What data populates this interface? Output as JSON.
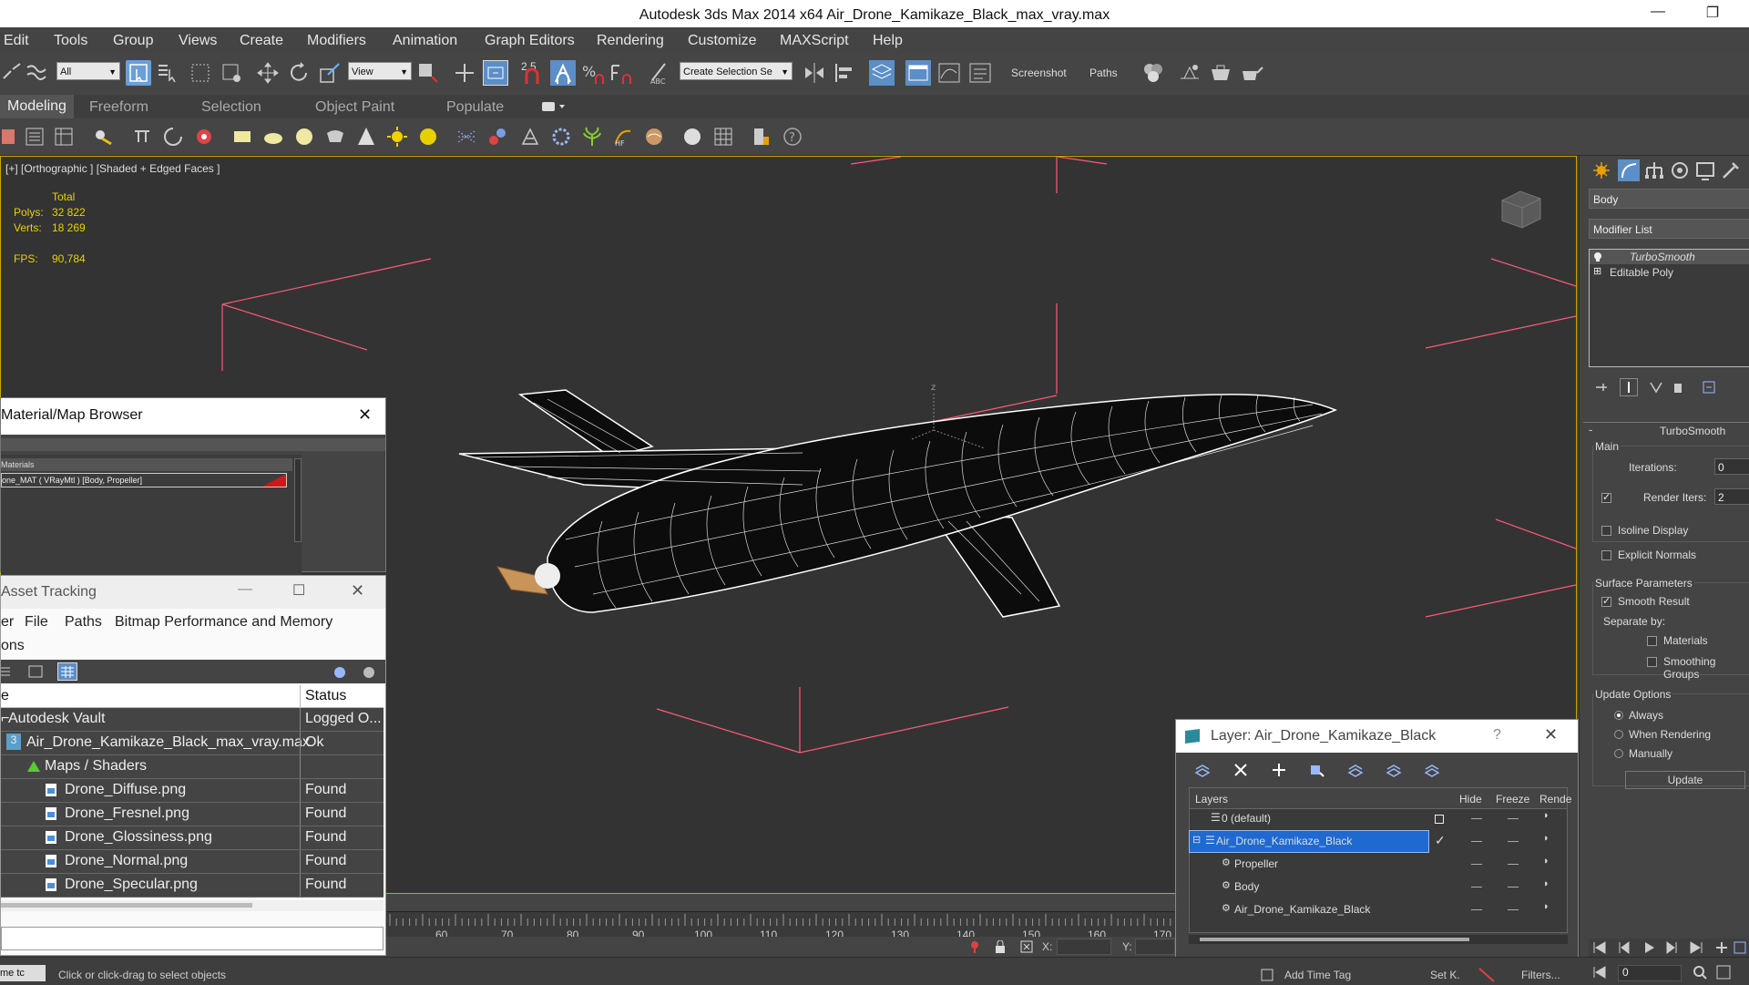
{
  "window": {
    "title": "Autodesk 3ds Max  2014 x64      Air_Drone_Kamikaze_Black_max_vray.max",
    "minimize": "—",
    "restore": "❐"
  },
  "menubar": [
    "Edit",
    "Tools",
    "Group",
    "Views",
    "Create",
    "Modifiers",
    "Animation",
    "Graph Editors",
    "Rendering",
    "Customize",
    "MAXScript",
    "Help"
  ],
  "toolbar": {
    "filter_combo": "All",
    "ref_coord_combo": "View",
    "snap_label": "2.5",
    "selection_set_combo": "Create Selection Se",
    "screenshot_label": "Screenshot",
    "paths_label": "Paths"
  },
  "ribbon_tabs": [
    "Modeling",
    "Freeform",
    "Selection",
    "Object Paint",
    "Populate"
  ],
  "viewport": {
    "label": "[+] [Orthographic ] [Shaded + Edged Faces ]",
    "stats": {
      "total_label": "Total",
      "polys_label": "Polys:",
      "polys_value": "32 822",
      "verts_label": "Verts:",
      "verts_value": "18 269",
      "fps_label": "FPS:",
      "fps_value": "90,784"
    },
    "axis_label": "z",
    "colors": {
      "bg": "#333333",
      "grid": "#ff5a78",
      "wire": "#ffffff",
      "border": "#c8a400"
    }
  },
  "command_panel": {
    "object_name": "Body",
    "modifier_list_label": "Modifier List",
    "stack": [
      "TurboSmooth",
      "Editable Poly"
    ],
    "rollout_title": "TurboSmooth",
    "main_label": "Main",
    "iterations_label": "Iterations:",
    "iterations_value": "0",
    "render_iters_label": "Render Iters:",
    "render_iters_value": "2",
    "isoline_label": "Isoline Display",
    "explicit_normals_label": "Explicit Normals",
    "surface_params_label": "Surface Parameters",
    "smooth_result_label": "Smooth Result",
    "separate_by_label": "Separate by:",
    "materials_label": "Materials",
    "smoothing_groups_label": "Smoothing Groups",
    "update_options_label": "Update Options",
    "always_label": "Always",
    "when_rendering_label": "When Rendering",
    "manually_label": "Manually",
    "update_button": "Update"
  },
  "material_browser": {
    "title": "Material/Map Browser",
    "close": "✕",
    "group_label": "Materials",
    "item": "one_MAT ( VRayMtl ) [Body, Propeller]",
    "swatch_color": "#d01818"
  },
  "asset_tracking": {
    "title": "Asset Tracking",
    "menu": [
      "er",
      "File",
      "Paths",
      "Bitmap Performance and Memory"
    ],
    "menu2": "ons",
    "col_name": "e",
    "col_status": "Status",
    "rows": [
      {
        "name": "Autodesk Vault",
        "status": "Logged O..."
      },
      {
        "name": "Air_Drone_Kamikaze_Black_max_vray.max",
        "status": "Ok"
      },
      {
        "name": "Maps / Shaders",
        "status": ""
      },
      {
        "name": "Drone_Diffuse.png",
        "status": "Found"
      },
      {
        "name": "Drone_Fresnel.png",
        "status": "Found"
      },
      {
        "name": "Drone_Glossiness.png",
        "status": "Found"
      },
      {
        "name": "Drone_Normal.png",
        "status": "Found"
      },
      {
        "name": "Drone_Specular.png",
        "status": "Found"
      }
    ]
  },
  "layer_dialog": {
    "title": "Layer: Air_Drone_Kamikaze_Black",
    "help": "?",
    "close": "✕",
    "col_layers": "Layers",
    "col_hide": "Hide",
    "col_freeze": "Freeze",
    "col_render": "Rende",
    "rows": [
      {
        "name": "0 (default)",
        "selected": false
      },
      {
        "name": "Air_Drone_Kamikaze_Black",
        "selected": true
      },
      {
        "name": "Propeller",
        "selected": false
      },
      {
        "name": "Body",
        "selected": false
      },
      {
        "name": "Air_Drone_Kamikaze_Black",
        "selected": false
      }
    ]
  },
  "timeline": {
    "ticks": [
      "60",
      "70",
      "80",
      "90",
      "100",
      "110",
      "120",
      "130",
      "140",
      "150",
      "160",
      "170"
    ],
    "x_label": "X:",
    "y_label": "Y:"
  },
  "statusbar": {
    "left_text": "me  tc",
    "prompt": "Click or click-drag to select objects",
    "add_time_tag": "Add Time Tag",
    "set_key": "Set K.",
    "filters": "Filters...",
    "frame_value": "0"
  }
}
